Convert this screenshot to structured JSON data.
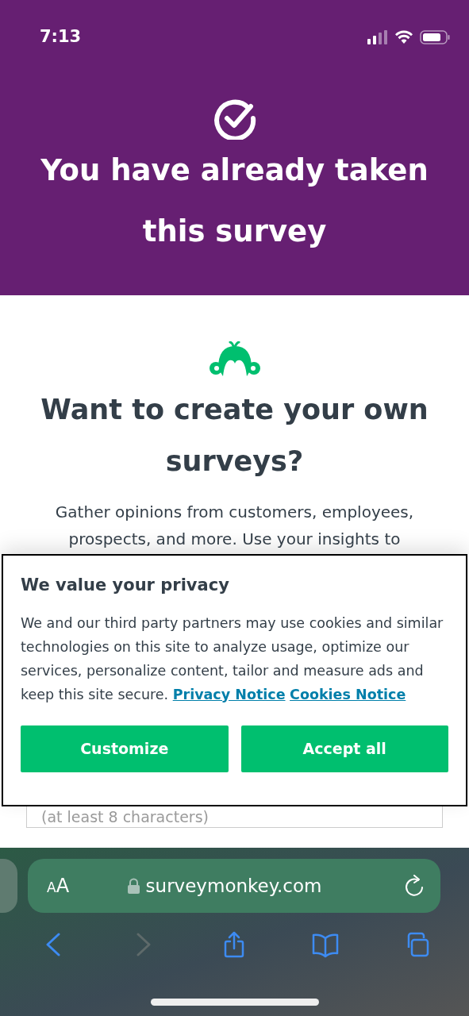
{
  "status_bar": {
    "time": "7:13"
  },
  "header": {
    "title": "You have already taken this survey"
  },
  "promo": {
    "heading": "Want to create your own surveys?",
    "text_lines": [
      "Gather opinions from customers, employees,",
      "prospects, and more. Use your insights to"
    ]
  },
  "cookie_banner": {
    "title": "We value your privacy",
    "text": "We and our third party partners may use cookies and similar technologies on this site to analyze usage, optimize our services, personalize content, tailor and measure ads and keep this site secure.",
    "links": [
      "Privacy Notice",
      "Cookies Notice"
    ],
    "buttons": [
      "Customize",
      "Accept all"
    ]
  },
  "password_field": {
    "placeholder": "(at least 8 characters)"
  },
  "browser": {
    "text_size_button": "AA",
    "url": "surveymonkey.com",
    "toolbar": [
      {
        "kind": "back",
        "disabled": false
      },
      {
        "kind": "forward",
        "disabled": true
      },
      {
        "kind": "share",
        "disabled": false
      },
      {
        "kind": "bookmarks",
        "disabled": false
      },
      {
        "kind": "tabs",
        "disabled": false
      }
    ]
  }
}
